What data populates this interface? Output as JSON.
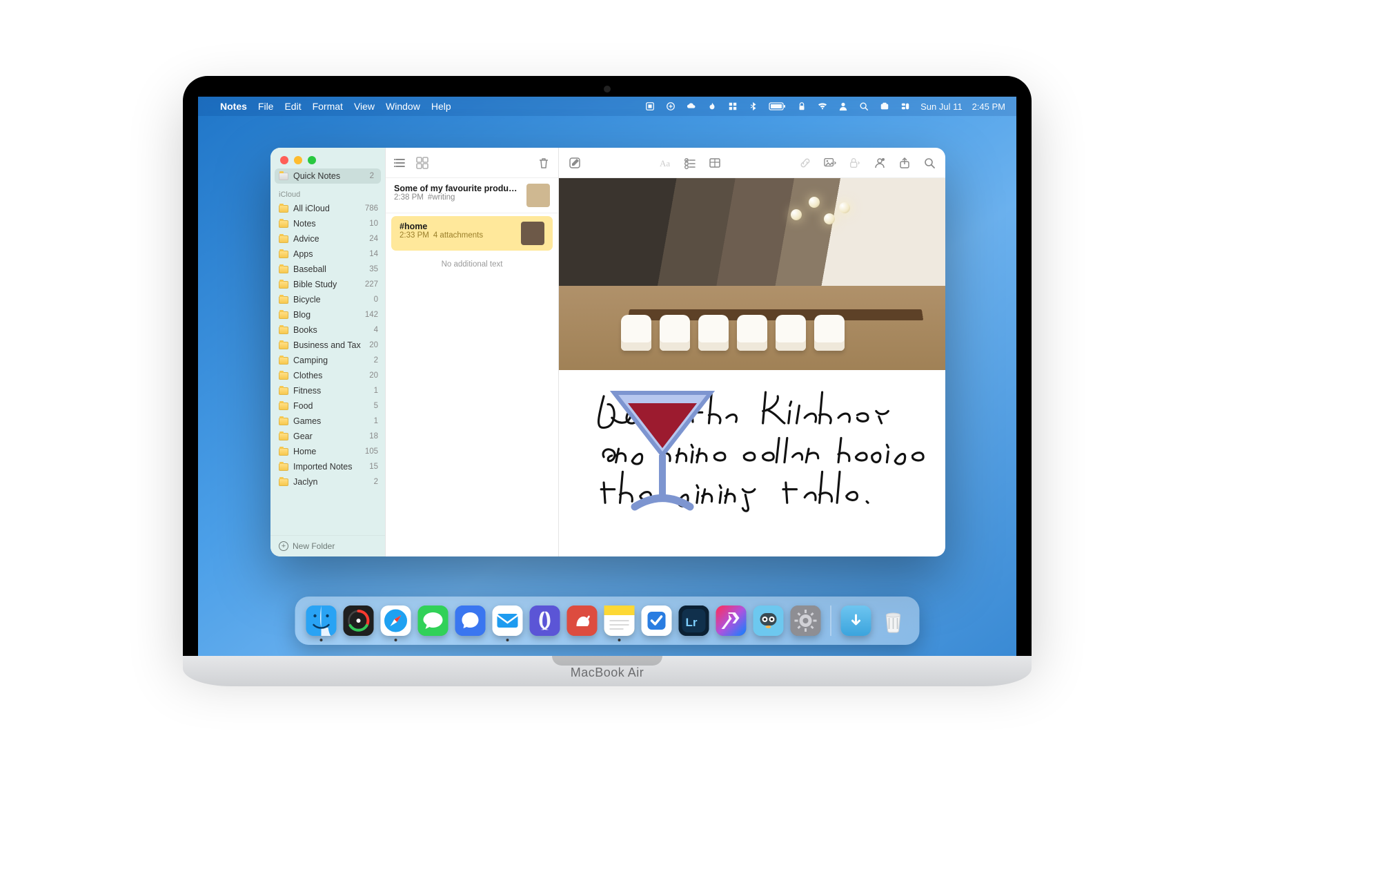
{
  "menubar": {
    "app_name": "Notes",
    "items": [
      "File",
      "Edit",
      "Format",
      "View",
      "Window",
      "Help"
    ],
    "status_icons": [
      "system-tray-icon",
      "envato-icon",
      "openai-icon",
      "snapchat-icon",
      "flame-icon",
      "grid-icon",
      "bluetooth-icon",
      "battery-icon",
      "lock-icon",
      "wifi-icon",
      "user-icon",
      "search-icon",
      "screen-mirror-icon",
      "control-center-icon"
    ],
    "date": "Sun Jul 11",
    "time": "2:45 PM"
  },
  "sidebar": {
    "quick_notes": {
      "label": "Quick Notes",
      "count": "2"
    },
    "section": "iCloud",
    "folders": [
      {
        "name": "All iCloud",
        "count": "786"
      },
      {
        "name": "Notes",
        "count": "10"
      },
      {
        "name": "Advice",
        "count": "24"
      },
      {
        "name": "Apps",
        "count": "14"
      },
      {
        "name": "Baseball",
        "count": "35"
      },
      {
        "name": "Bible Study",
        "count": "227"
      },
      {
        "name": "Bicycle",
        "count": "0"
      },
      {
        "name": "Blog",
        "count": "142"
      },
      {
        "name": "Books",
        "count": "4"
      },
      {
        "name": "Business and Tax",
        "count": "20"
      },
      {
        "name": "Camping",
        "count": "2"
      },
      {
        "name": "Clothes",
        "count": "20"
      },
      {
        "name": "Fitness",
        "count": "1"
      },
      {
        "name": "Food",
        "count": "5"
      },
      {
        "name": "Games",
        "count": "1"
      },
      {
        "name": "Gear",
        "count": "18"
      },
      {
        "name": "Home",
        "count": "105"
      },
      {
        "name": "Imported Notes",
        "count": "15"
      },
      {
        "name": "Jaclyn",
        "count": "2"
      }
    ],
    "new_folder": "New Folder"
  },
  "list": {
    "notes": [
      {
        "title": "Some of my favourite produc…",
        "time": "2:38 PM",
        "meta": "#writing",
        "selected": false,
        "thumb_color": "#cfb891"
      },
      {
        "title": "#home",
        "time": "2:33 PM",
        "meta": "4 attachments",
        "selected": true,
        "thumb_color": "#6d5948"
      }
    ],
    "footer": "No additional text"
  },
  "note_body": {
    "handwriting_lines": [
      "Love the kitchen",
      "and wine cellar beside",
      "the dining table."
    ],
    "emoji_name": "martini-glass-icon"
  },
  "dock": {
    "apps": [
      {
        "name": "finder",
        "color": "#2aa9f5",
        "running": true
      },
      {
        "name": "activity-monitor",
        "color": "#2b2b2b"
      },
      {
        "name": "safari",
        "color": "#1e9bf0",
        "running": true
      },
      {
        "name": "messages",
        "color": "#31d158"
      },
      {
        "name": "signal",
        "color": "#3a76f0"
      },
      {
        "name": "mail",
        "color": "#ffffff",
        "running": true
      },
      {
        "name": "discord-alt",
        "color": "#5865f2"
      },
      {
        "name": "bear",
        "color": "#dd4c3f"
      },
      {
        "name": "notes",
        "color": "#fdd835",
        "running": true
      },
      {
        "name": "things",
        "color": "#ffffff"
      },
      {
        "name": "lightroom",
        "color": "#0b2033"
      },
      {
        "name": "shortcuts",
        "color": "#ff2d55"
      },
      {
        "name": "tweetbot",
        "color": "#6dc8ef"
      },
      {
        "name": "system-preferences",
        "color": "#7a7a7a"
      }
    ],
    "tray": [
      {
        "name": "downloads-folder"
      },
      {
        "name": "trash"
      }
    ]
  },
  "hardware": {
    "label": "MacBook Air"
  }
}
